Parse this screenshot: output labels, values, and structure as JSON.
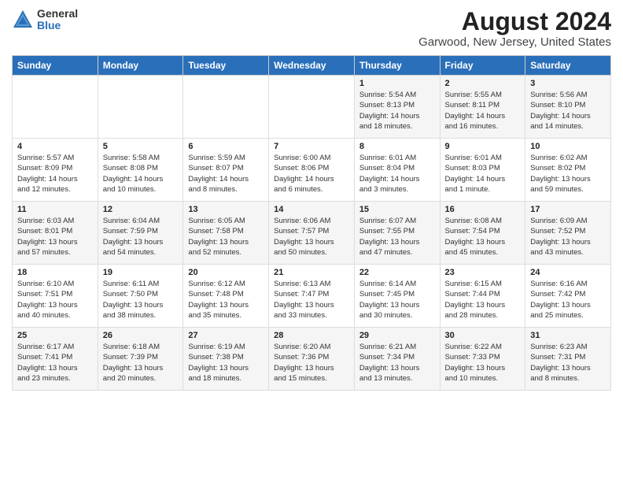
{
  "logo": {
    "general": "General",
    "blue": "Blue"
  },
  "title": "August 2024",
  "subtitle": "Garwood, New Jersey, United States",
  "days_of_week": [
    "Sunday",
    "Monday",
    "Tuesday",
    "Wednesday",
    "Thursday",
    "Friday",
    "Saturday"
  ],
  "weeks": [
    [
      {
        "day": "",
        "info": ""
      },
      {
        "day": "",
        "info": ""
      },
      {
        "day": "",
        "info": ""
      },
      {
        "day": "",
        "info": ""
      },
      {
        "day": "1",
        "info": "Sunrise: 5:54 AM\nSunset: 8:13 PM\nDaylight: 14 hours\nand 18 minutes."
      },
      {
        "day": "2",
        "info": "Sunrise: 5:55 AM\nSunset: 8:11 PM\nDaylight: 14 hours\nand 16 minutes."
      },
      {
        "day": "3",
        "info": "Sunrise: 5:56 AM\nSunset: 8:10 PM\nDaylight: 14 hours\nand 14 minutes."
      }
    ],
    [
      {
        "day": "4",
        "info": "Sunrise: 5:57 AM\nSunset: 8:09 PM\nDaylight: 14 hours\nand 12 minutes."
      },
      {
        "day": "5",
        "info": "Sunrise: 5:58 AM\nSunset: 8:08 PM\nDaylight: 14 hours\nand 10 minutes."
      },
      {
        "day": "6",
        "info": "Sunrise: 5:59 AM\nSunset: 8:07 PM\nDaylight: 14 hours\nand 8 minutes."
      },
      {
        "day": "7",
        "info": "Sunrise: 6:00 AM\nSunset: 8:06 PM\nDaylight: 14 hours\nand 6 minutes."
      },
      {
        "day": "8",
        "info": "Sunrise: 6:01 AM\nSunset: 8:04 PM\nDaylight: 14 hours\nand 3 minutes."
      },
      {
        "day": "9",
        "info": "Sunrise: 6:01 AM\nSunset: 8:03 PM\nDaylight: 14 hours\nand 1 minute."
      },
      {
        "day": "10",
        "info": "Sunrise: 6:02 AM\nSunset: 8:02 PM\nDaylight: 13 hours\nand 59 minutes."
      }
    ],
    [
      {
        "day": "11",
        "info": "Sunrise: 6:03 AM\nSunset: 8:01 PM\nDaylight: 13 hours\nand 57 minutes."
      },
      {
        "day": "12",
        "info": "Sunrise: 6:04 AM\nSunset: 7:59 PM\nDaylight: 13 hours\nand 54 minutes."
      },
      {
        "day": "13",
        "info": "Sunrise: 6:05 AM\nSunset: 7:58 PM\nDaylight: 13 hours\nand 52 minutes."
      },
      {
        "day": "14",
        "info": "Sunrise: 6:06 AM\nSunset: 7:57 PM\nDaylight: 13 hours\nand 50 minutes."
      },
      {
        "day": "15",
        "info": "Sunrise: 6:07 AM\nSunset: 7:55 PM\nDaylight: 13 hours\nand 47 minutes."
      },
      {
        "day": "16",
        "info": "Sunrise: 6:08 AM\nSunset: 7:54 PM\nDaylight: 13 hours\nand 45 minutes."
      },
      {
        "day": "17",
        "info": "Sunrise: 6:09 AM\nSunset: 7:52 PM\nDaylight: 13 hours\nand 43 minutes."
      }
    ],
    [
      {
        "day": "18",
        "info": "Sunrise: 6:10 AM\nSunset: 7:51 PM\nDaylight: 13 hours\nand 40 minutes."
      },
      {
        "day": "19",
        "info": "Sunrise: 6:11 AM\nSunset: 7:50 PM\nDaylight: 13 hours\nand 38 minutes."
      },
      {
        "day": "20",
        "info": "Sunrise: 6:12 AM\nSunset: 7:48 PM\nDaylight: 13 hours\nand 35 minutes."
      },
      {
        "day": "21",
        "info": "Sunrise: 6:13 AM\nSunset: 7:47 PM\nDaylight: 13 hours\nand 33 minutes."
      },
      {
        "day": "22",
        "info": "Sunrise: 6:14 AM\nSunset: 7:45 PM\nDaylight: 13 hours\nand 30 minutes."
      },
      {
        "day": "23",
        "info": "Sunrise: 6:15 AM\nSunset: 7:44 PM\nDaylight: 13 hours\nand 28 minutes."
      },
      {
        "day": "24",
        "info": "Sunrise: 6:16 AM\nSunset: 7:42 PM\nDaylight: 13 hours\nand 25 minutes."
      }
    ],
    [
      {
        "day": "25",
        "info": "Sunrise: 6:17 AM\nSunset: 7:41 PM\nDaylight: 13 hours\nand 23 minutes."
      },
      {
        "day": "26",
        "info": "Sunrise: 6:18 AM\nSunset: 7:39 PM\nDaylight: 13 hours\nand 20 minutes."
      },
      {
        "day": "27",
        "info": "Sunrise: 6:19 AM\nSunset: 7:38 PM\nDaylight: 13 hours\nand 18 minutes."
      },
      {
        "day": "28",
        "info": "Sunrise: 6:20 AM\nSunset: 7:36 PM\nDaylight: 13 hours\nand 15 minutes."
      },
      {
        "day": "29",
        "info": "Sunrise: 6:21 AM\nSunset: 7:34 PM\nDaylight: 13 hours\nand 13 minutes."
      },
      {
        "day": "30",
        "info": "Sunrise: 6:22 AM\nSunset: 7:33 PM\nDaylight: 13 hours\nand 10 minutes."
      },
      {
        "day": "31",
        "info": "Sunrise: 6:23 AM\nSunset: 7:31 PM\nDaylight: 13 hours\nand 8 minutes."
      }
    ]
  ]
}
